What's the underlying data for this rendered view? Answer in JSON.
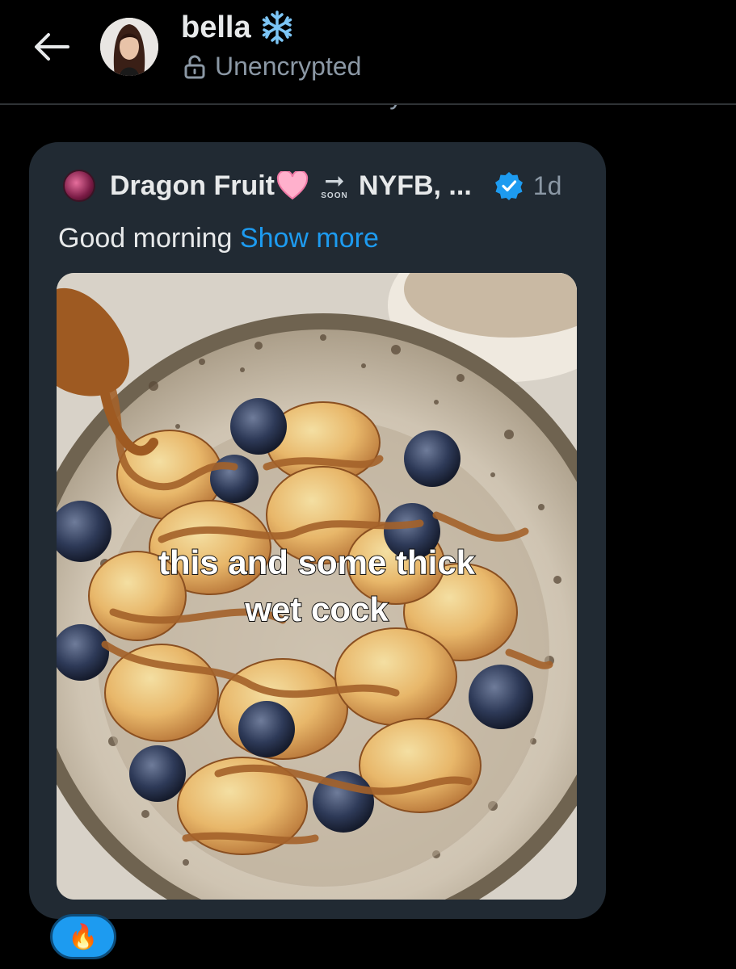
{
  "header": {
    "back_icon": "back-arrow-icon",
    "contact_name": "bella",
    "name_emoji_icon": "snowflake-icon",
    "encryption_icon": "unlocked-padlock-icon",
    "encryption_status": "Unencrypted"
  },
  "date_separator": "Today",
  "message": {
    "quoted_post": {
      "author_display_name_part1": "Dragon Fruit",
      "author_heart_icon": "pink-heart-icon",
      "author_soon_label": "SOON",
      "author_display_name_part2": "NYFB, ...",
      "verified_icon": "verified-badge-icon",
      "timestamp": "1d",
      "text": "Good morning",
      "show_more_label": "Show more",
      "image_caption_line1": "this and some thick",
      "image_caption_line2": "wet cock"
    },
    "reaction": {
      "icon": "fire-icon",
      "emoji": "🔥"
    }
  },
  "colors": {
    "background": "#000000",
    "bubble": "#212a33",
    "accent": "#1d9bf0",
    "secondary_text": "#8b98a5",
    "primary_text": "#e7e9ea"
  }
}
